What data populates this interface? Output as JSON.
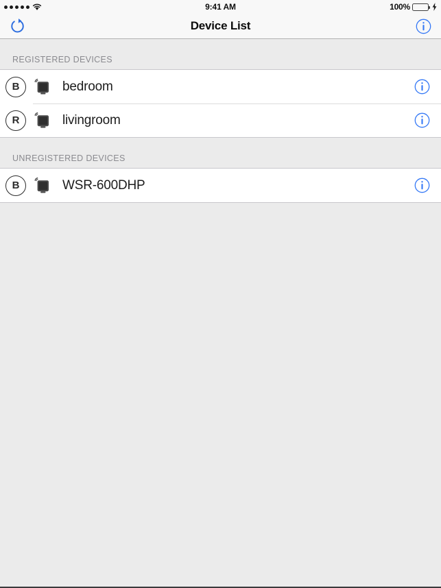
{
  "status_bar": {
    "signal_dots": 5,
    "wifi_icon": "wifi-icon",
    "time": "9:41 AM",
    "battery_percent": "100%",
    "battery_level": 100,
    "battery_icon": "battery-icon",
    "charging_icon": "bolt-icon"
  },
  "nav_bar": {
    "title": "Device List",
    "refresh_icon": "refresh-icon",
    "info_icon": "info-circle-icon"
  },
  "colors": {
    "accent_blue": "#3478f6",
    "battery_green": "#4cd452",
    "background_gray": "#ebebeb",
    "row_white": "#ffffff",
    "header_text_gray": "#8a8a8f",
    "separator": "#c8c7cc"
  },
  "sections": [
    {
      "header": "REGISTERED DEVICES",
      "rows": [
        {
          "badge": "B",
          "device_icon": "router-icon",
          "label": "bedroom",
          "info_icon": "info-circle-icon"
        },
        {
          "badge": "R",
          "device_icon": "router-icon",
          "label": "livingroom",
          "info_icon": "info-circle-icon"
        }
      ]
    },
    {
      "header": "UNREGISTERED DEVICES",
      "rows": [
        {
          "badge": "B",
          "device_icon": "router-icon",
          "label": "WSR-600DHP",
          "info_icon": "info-circle-icon"
        }
      ]
    }
  ]
}
